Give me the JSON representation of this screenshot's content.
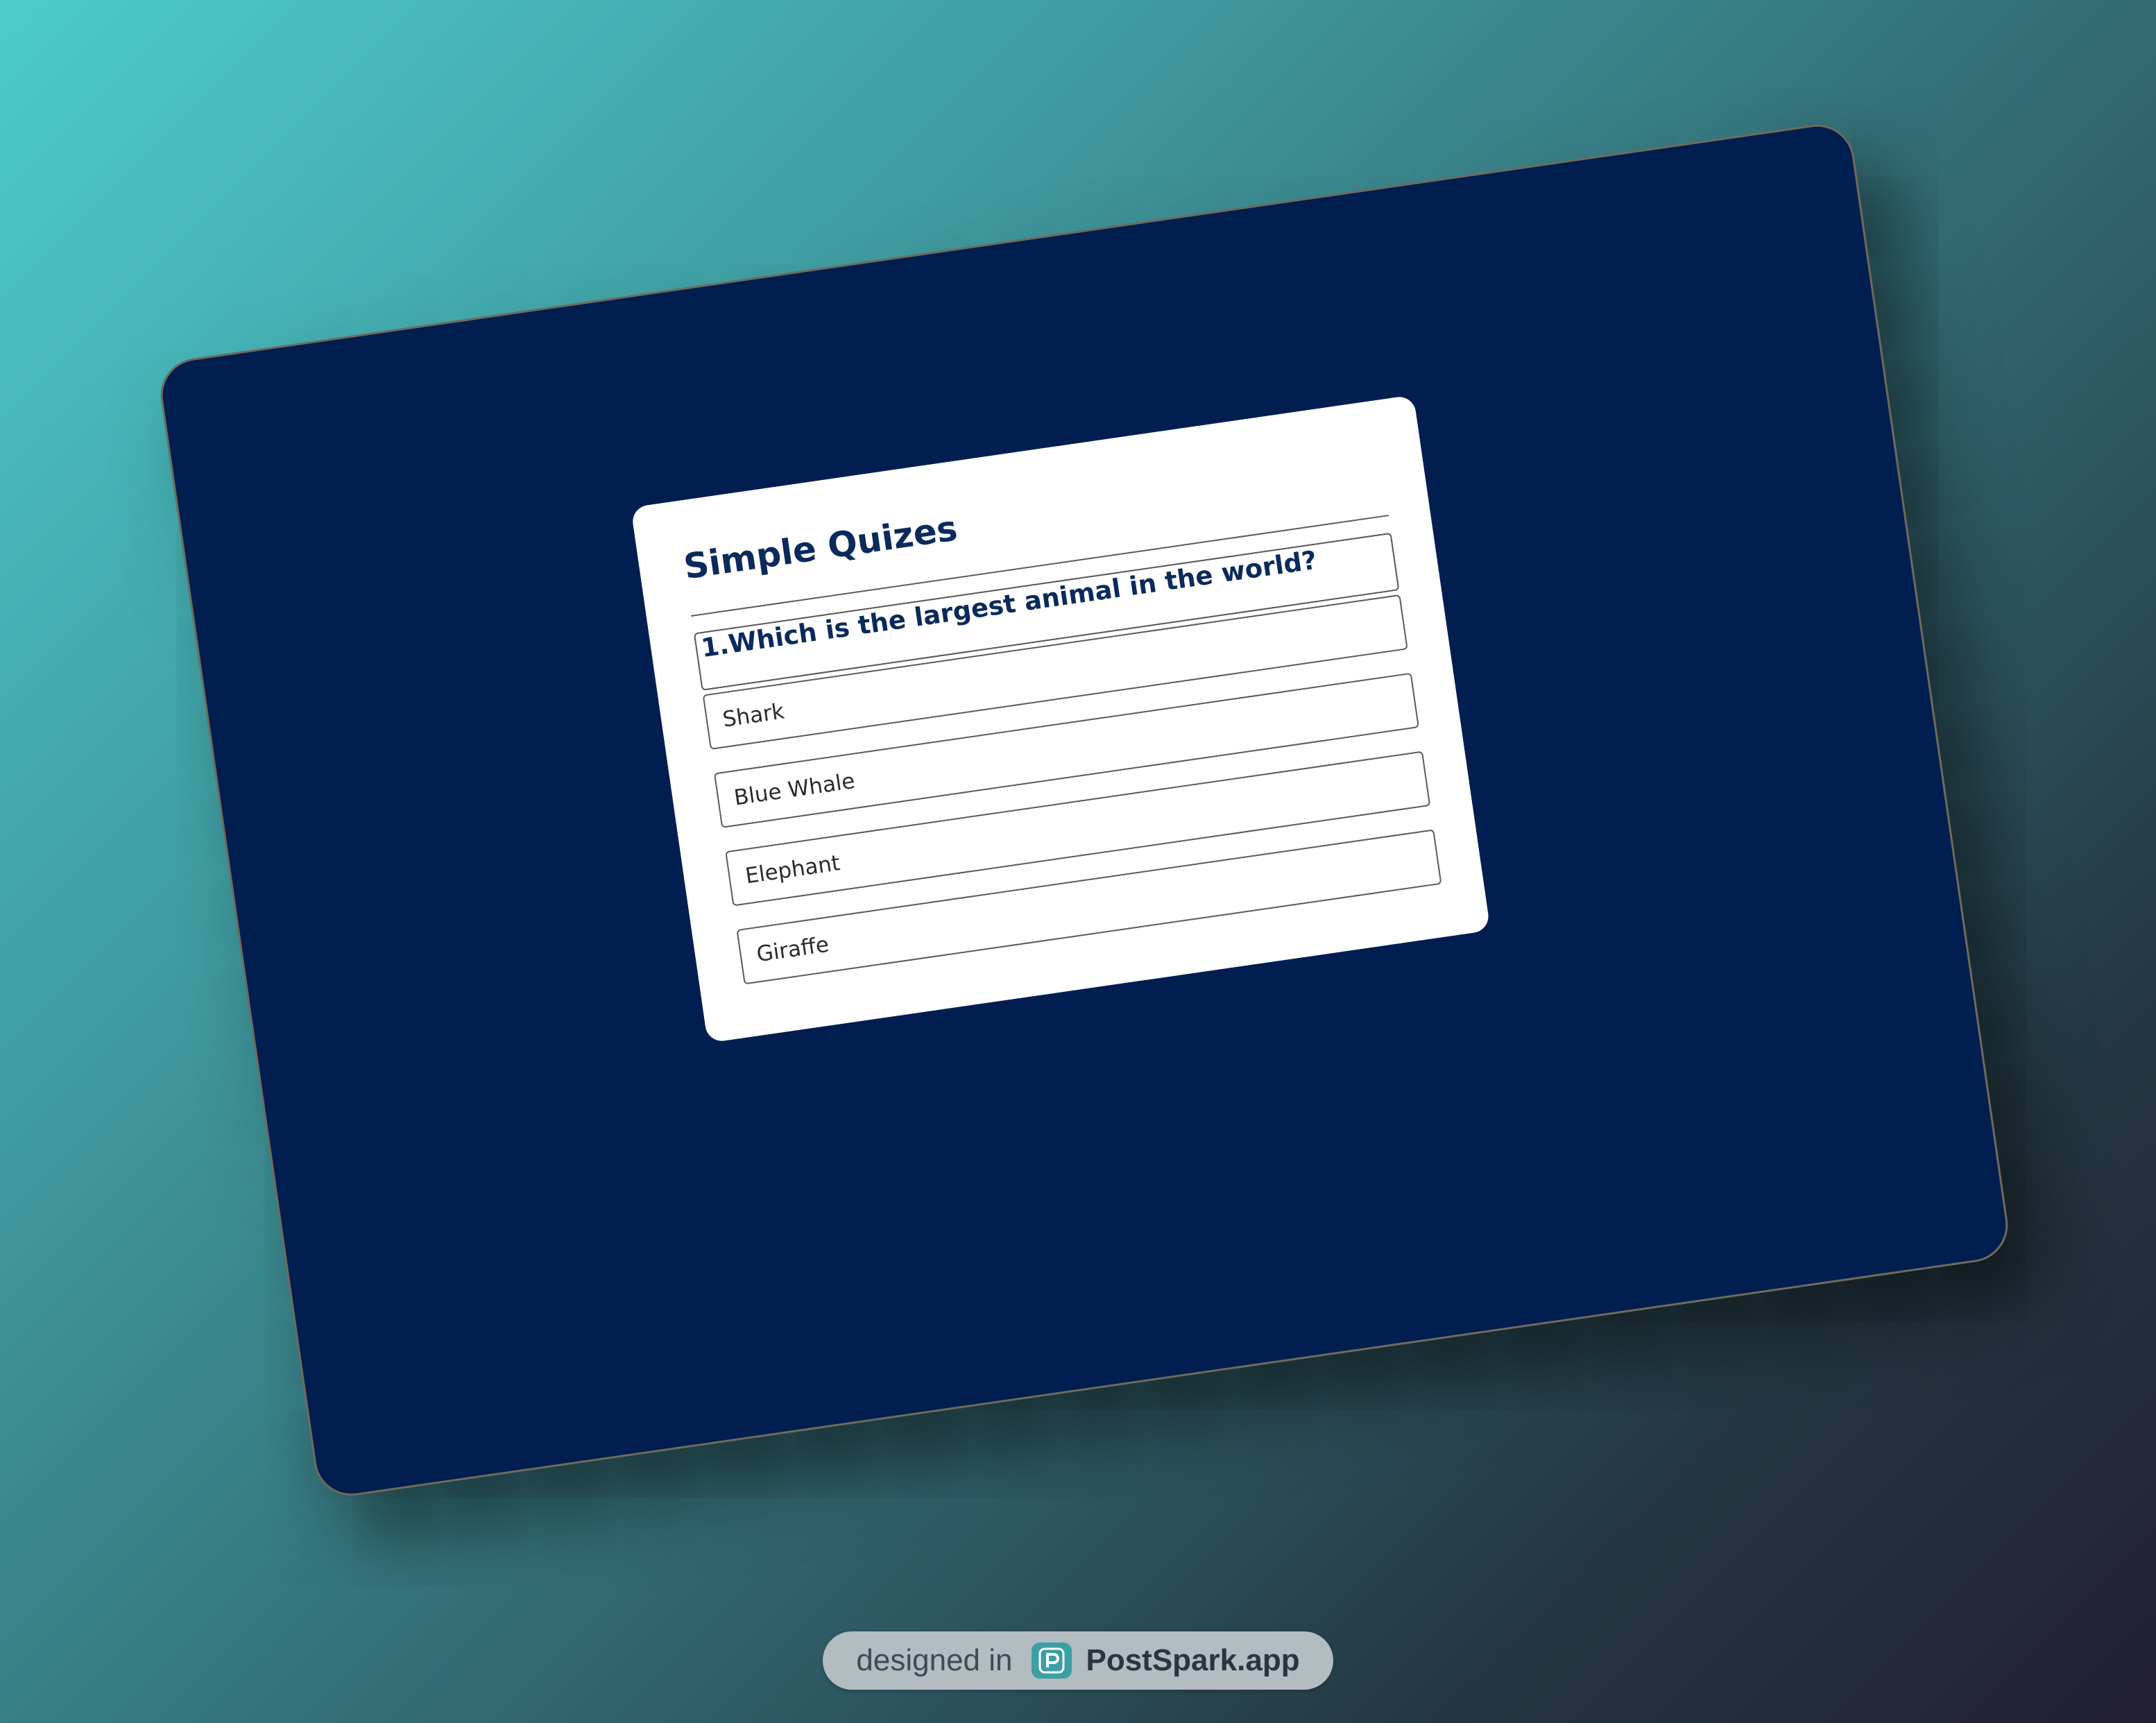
{
  "quiz": {
    "title": "Simple Quizes",
    "question": "1.Which is the largest animal in the world?",
    "options": [
      {
        "label": "Shark"
      },
      {
        "label": "Blue Whale"
      },
      {
        "label": "Elephant"
      },
      {
        "label": "Giraffe"
      }
    ]
  },
  "badge": {
    "prefix": "designed in",
    "brand": "PostSpark.app",
    "logo_icon": "postspark-logo-icon"
  },
  "colors": {
    "background_gradient": [
      "#4ccbcb",
      "#2f5e68",
      "#231f33"
    ],
    "frame": "#001e4f",
    "card": "#ffffff",
    "title_text": "#0b2a5c",
    "badge_bg": "#b3bcc1",
    "logo_accent": "#3b9fa4"
  }
}
